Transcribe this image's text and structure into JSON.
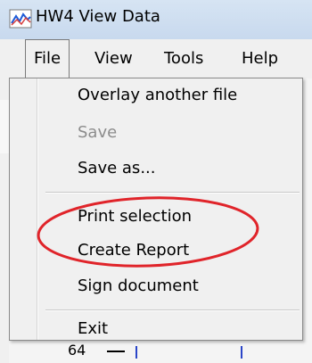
{
  "window": {
    "title": "HW4 View Data"
  },
  "menubar": {
    "file": "File",
    "view": "View",
    "tools": "Tools",
    "help": "Help"
  },
  "file_menu": {
    "items": [
      {
        "label": "Overlay another file",
        "enabled": true
      },
      {
        "label": "Save",
        "enabled": false
      },
      {
        "label": "Save as...",
        "enabled": true
      },
      {
        "label": "Print selection",
        "enabled": true
      },
      {
        "label": "Create Report",
        "enabled": true
      },
      {
        "label": "Sign document",
        "enabled": true
      },
      {
        "label": "Exit",
        "enabled": true
      }
    ]
  },
  "background": {
    "row_label": "64"
  },
  "colors": {
    "highlight_oval": "#e0242a",
    "titlebar": "#c8d9ee",
    "menu_bg": "#f0f0f0"
  },
  "icons": {
    "app": "chart-line-icon"
  }
}
